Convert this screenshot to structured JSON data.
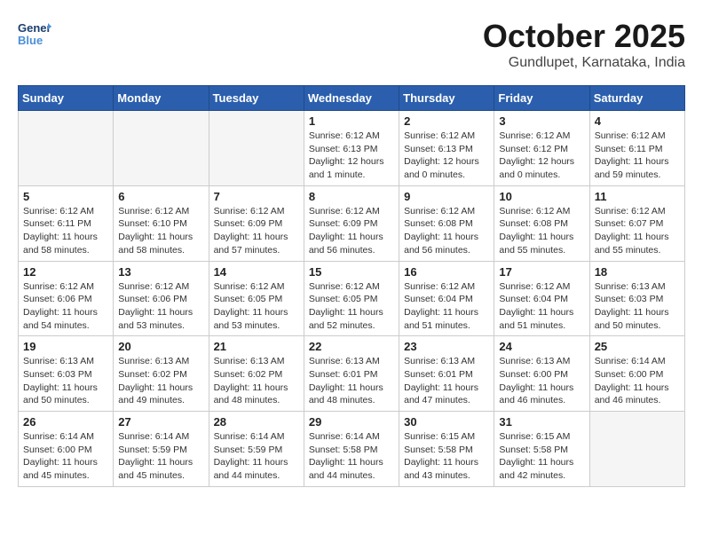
{
  "header": {
    "logo_line1": "General",
    "logo_line2": "Blue",
    "month": "October 2025",
    "location": "Gundlupet, Karnataka, India"
  },
  "weekdays": [
    "Sunday",
    "Monday",
    "Tuesday",
    "Wednesday",
    "Thursday",
    "Friday",
    "Saturday"
  ],
  "weeks": [
    [
      {
        "day": "",
        "info": ""
      },
      {
        "day": "",
        "info": ""
      },
      {
        "day": "",
        "info": ""
      },
      {
        "day": "1",
        "info": "Sunrise: 6:12 AM\nSunset: 6:13 PM\nDaylight: 12 hours\nand 1 minute."
      },
      {
        "day": "2",
        "info": "Sunrise: 6:12 AM\nSunset: 6:13 PM\nDaylight: 12 hours\nand 0 minutes."
      },
      {
        "day": "3",
        "info": "Sunrise: 6:12 AM\nSunset: 6:12 PM\nDaylight: 12 hours\nand 0 minutes."
      },
      {
        "day": "4",
        "info": "Sunrise: 6:12 AM\nSunset: 6:11 PM\nDaylight: 11 hours\nand 59 minutes."
      }
    ],
    [
      {
        "day": "5",
        "info": "Sunrise: 6:12 AM\nSunset: 6:11 PM\nDaylight: 11 hours\nand 58 minutes."
      },
      {
        "day": "6",
        "info": "Sunrise: 6:12 AM\nSunset: 6:10 PM\nDaylight: 11 hours\nand 58 minutes."
      },
      {
        "day": "7",
        "info": "Sunrise: 6:12 AM\nSunset: 6:09 PM\nDaylight: 11 hours\nand 57 minutes."
      },
      {
        "day": "8",
        "info": "Sunrise: 6:12 AM\nSunset: 6:09 PM\nDaylight: 11 hours\nand 56 minutes."
      },
      {
        "day": "9",
        "info": "Sunrise: 6:12 AM\nSunset: 6:08 PM\nDaylight: 11 hours\nand 56 minutes."
      },
      {
        "day": "10",
        "info": "Sunrise: 6:12 AM\nSunset: 6:08 PM\nDaylight: 11 hours\nand 55 minutes."
      },
      {
        "day": "11",
        "info": "Sunrise: 6:12 AM\nSunset: 6:07 PM\nDaylight: 11 hours\nand 55 minutes."
      }
    ],
    [
      {
        "day": "12",
        "info": "Sunrise: 6:12 AM\nSunset: 6:06 PM\nDaylight: 11 hours\nand 54 minutes."
      },
      {
        "day": "13",
        "info": "Sunrise: 6:12 AM\nSunset: 6:06 PM\nDaylight: 11 hours\nand 53 minutes."
      },
      {
        "day": "14",
        "info": "Sunrise: 6:12 AM\nSunset: 6:05 PM\nDaylight: 11 hours\nand 53 minutes."
      },
      {
        "day": "15",
        "info": "Sunrise: 6:12 AM\nSunset: 6:05 PM\nDaylight: 11 hours\nand 52 minutes."
      },
      {
        "day": "16",
        "info": "Sunrise: 6:12 AM\nSunset: 6:04 PM\nDaylight: 11 hours\nand 51 minutes."
      },
      {
        "day": "17",
        "info": "Sunrise: 6:12 AM\nSunset: 6:04 PM\nDaylight: 11 hours\nand 51 minutes."
      },
      {
        "day": "18",
        "info": "Sunrise: 6:13 AM\nSunset: 6:03 PM\nDaylight: 11 hours\nand 50 minutes."
      }
    ],
    [
      {
        "day": "19",
        "info": "Sunrise: 6:13 AM\nSunset: 6:03 PM\nDaylight: 11 hours\nand 50 minutes."
      },
      {
        "day": "20",
        "info": "Sunrise: 6:13 AM\nSunset: 6:02 PM\nDaylight: 11 hours\nand 49 minutes."
      },
      {
        "day": "21",
        "info": "Sunrise: 6:13 AM\nSunset: 6:02 PM\nDaylight: 11 hours\nand 48 minutes."
      },
      {
        "day": "22",
        "info": "Sunrise: 6:13 AM\nSunset: 6:01 PM\nDaylight: 11 hours\nand 48 minutes."
      },
      {
        "day": "23",
        "info": "Sunrise: 6:13 AM\nSunset: 6:01 PM\nDaylight: 11 hours\nand 47 minutes."
      },
      {
        "day": "24",
        "info": "Sunrise: 6:13 AM\nSunset: 6:00 PM\nDaylight: 11 hours\nand 46 minutes."
      },
      {
        "day": "25",
        "info": "Sunrise: 6:14 AM\nSunset: 6:00 PM\nDaylight: 11 hours\nand 46 minutes."
      }
    ],
    [
      {
        "day": "26",
        "info": "Sunrise: 6:14 AM\nSunset: 6:00 PM\nDaylight: 11 hours\nand 45 minutes."
      },
      {
        "day": "27",
        "info": "Sunrise: 6:14 AM\nSunset: 5:59 PM\nDaylight: 11 hours\nand 45 minutes."
      },
      {
        "day": "28",
        "info": "Sunrise: 6:14 AM\nSunset: 5:59 PM\nDaylight: 11 hours\nand 44 minutes."
      },
      {
        "day": "29",
        "info": "Sunrise: 6:14 AM\nSunset: 5:58 PM\nDaylight: 11 hours\nand 44 minutes."
      },
      {
        "day": "30",
        "info": "Sunrise: 6:15 AM\nSunset: 5:58 PM\nDaylight: 11 hours\nand 43 minutes."
      },
      {
        "day": "31",
        "info": "Sunrise: 6:15 AM\nSunset: 5:58 PM\nDaylight: 11 hours\nand 42 minutes."
      },
      {
        "day": "",
        "info": ""
      }
    ]
  ]
}
